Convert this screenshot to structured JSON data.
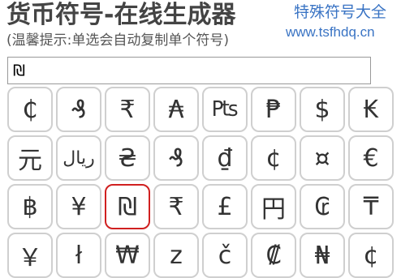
{
  "header": {
    "title": "货币符号-在线生成器",
    "subtitle": "(温馨提示:单选会自动复制单个符号)",
    "brand_name": "特殊符号大全",
    "brand_url": "www.tsfhdq.cn"
  },
  "result": {
    "value": "₪"
  },
  "symbols": [
    "₵",
    "₰",
    "₹",
    "₳",
    "₧",
    "₱",
    "$",
    "₭",
    "元",
    "ریال",
    "₴",
    "₰",
    "₫",
    "¢",
    "¤",
    "€",
    "฿",
    "¥",
    "₪",
    "₹",
    "£",
    "円",
    "₢",
    "₸",
    "￥",
    "ł",
    "₩",
    "z",
    "č",
    "₡",
    "₦",
    "¢"
  ],
  "selected_index": 18
}
